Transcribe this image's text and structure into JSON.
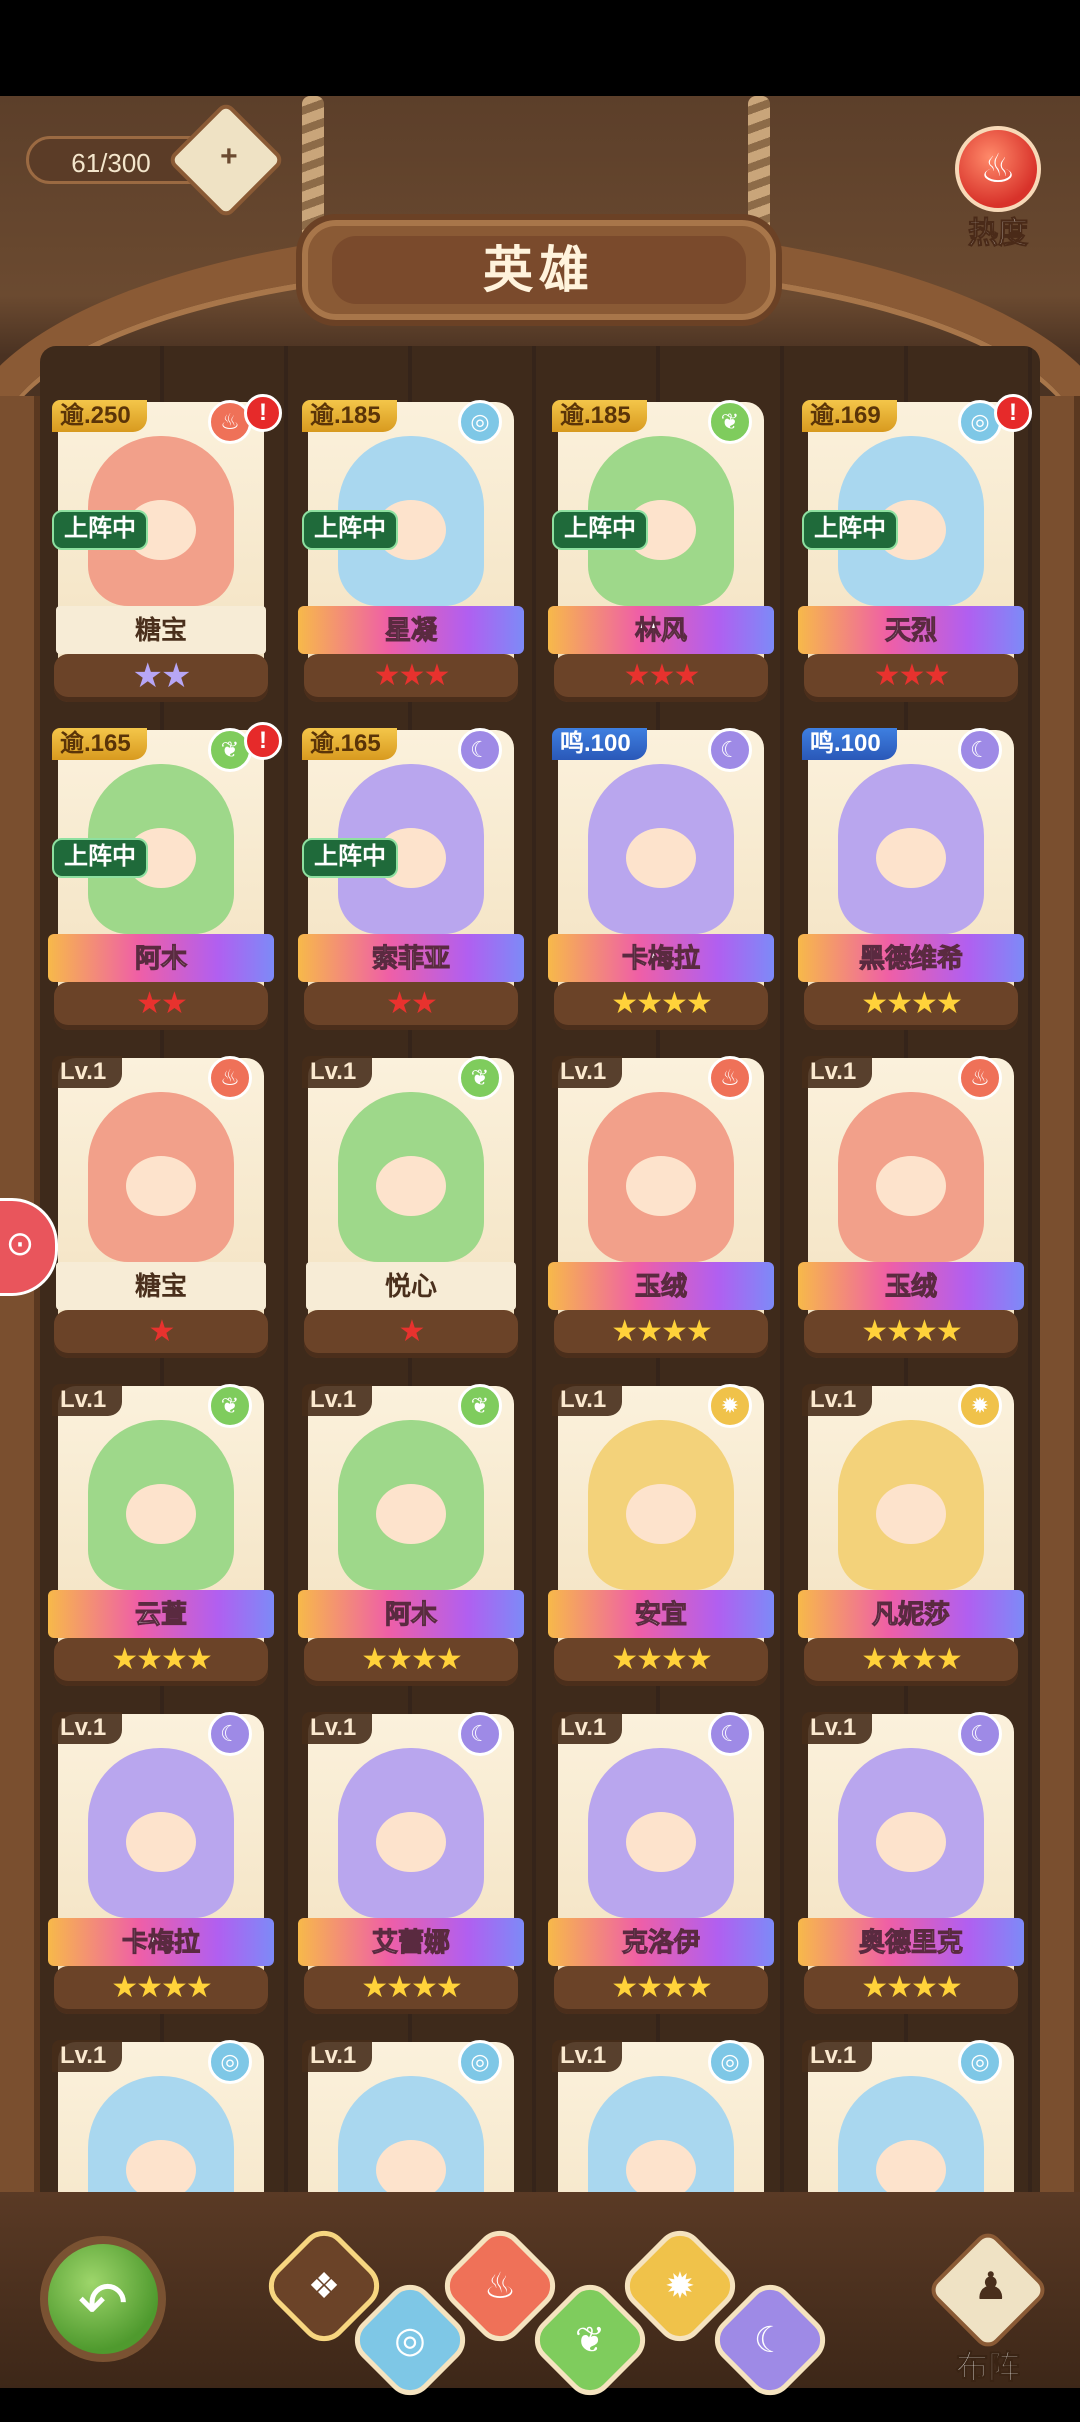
{
  "header": {
    "counter": "61/300",
    "counter_icon": "hero-capacity-icon",
    "hot_label": "热度",
    "title": "英雄"
  },
  "colors": {
    "fire": "#ef7158",
    "water": "#7ec7e6",
    "leaf": "#7fcc5d",
    "moon": "#9e8ae6",
    "sun": "#f0c24a"
  },
  "heroes": [
    {
      "tag": "逾.250",
      "tag_style": "gold",
      "element": "fire",
      "alert": "!",
      "active": "上阵中",
      "name": "糖宝",
      "stars": "★★",
      "stars_style": "purple",
      "ribbon": "plain"
    },
    {
      "tag": "逾.185",
      "tag_style": "gold",
      "element": "water",
      "alert": "",
      "active": "上阵中",
      "name": "星凝",
      "stars": "★★★",
      "stars_style": "red",
      "ribbon": "rainbow"
    },
    {
      "tag": "逾.185",
      "tag_style": "gold",
      "element": "leaf",
      "alert": "",
      "active": "上阵中",
      "name": "林风",
      "stars": "★★★",
      "stars_style": "red",
      "ribbon": "rainbow"
    },
    {
      "tag": "逾.169",
      "tag_style": "gold",
      "element": "water",
      "alert": "!",
      "active": "上阵中",
      "name": "天烈",
      "stars": "★★★",
      "stars_style": "red",
      "ribbon": "rainbow"
    },
    {
      "tag": "逾.165",
      "tag_style": "gold",
      "element": "leaf",
      "alert": "!",
      "active": "上阵中",
      "name": "阿木",
      "stars": "★★",
      "stars_style": "red",
      "ribbon": "rainbow"
    },
    {
      "tag": "逾.165",
      "tag_style": "gold",
      "element": "moon",
      "alert": "",
      "active": "上阵中",
      "name": "索菲亚",
      "stars": "★★",
      "stars_style": "red",
      "ribbon": "rainbow"
    },
    {
      "tag": "鸣.100",
      "tag_style": "blue",
      "element": "moon",
      "alert": "",
      "active": "",
      "name": "卡梅拉",
      "stars": "★★★★",
      "stars_style": "gold",
      "ribbon": "rainbow"
    },
    {
      "tag": "鸣.100",
      "tag_style": "blue",
      "element": "moon",
      "alert": "",
      "active": "",
      "name": "黑德维希",
      "stars": "★★★★",
      "stars_style": "gold",
      "ribbon": "rainbow"
    },
    {
      "tag": "Lv.1",
      "tag_style": "dark",
      "element": "fire",
      "alert": "",
      "active": "",
      "name": "糖宝",
      "stars": "★",
      "stars_style": "red",
      "ribbon": "plain"
    },
    {
      "tag": "Lv.1",
      "tag_style": "dark",
      "element": "leaf",
      "alert": "",
      "active": "",
      "name": "悦心",
      "stars": "★",
      "stars_style": "red",
      "ribbon": "plain"
    },
    {
      "tag": "Lv.1",
      "tag_style": "dark",
      "element": "fire",
      "alert": "",
      "active": "",
      "name": "玉绒",
      "stars": "★★★★",
      "stars_style": "gold",
      "ribbon": "rainbow"
    },
    {
      "tag": "Lv.1",
      "tag_style": "dark",
      "element": "fire",
      "alert": "",
      "active": "",
      "name": "玉绒",
      "stars": "★★★★",
      "stars_style": "gold",
      "ribbon": "rainbow"
    },
    {
      "tag": "Lv.1",
      "tag_style": "dark",
      "element": "leaf",
      "alert": "",
      "active": "",
      "name": "云萱",
      "stars": "★★★★",
      "stars_style": "gold",
      "ribbon": "rainbow"
    },
    {
      "tag": "Lv.1",
      "tag_style": "dark",
      "element": "leaf",
      "alert": "",
      "active": "",
      "name": "阿木",
      "stars": "★★★★",
      "stars_style": "gold",
      "ribbon": "rainbow"
    },
    {
      "tag": "Lv.1",
      "tag_style": "dark",
      "element": "sun",
      "alert": "",
      "active": "",
      "name": "安宜",
      "stars": "★★★★",
      "stars_style": "gold",
      "ribbon": "rainbow"
    },
    {
      "tag": "Lv.1",
      "tag_style": "dark",
      "element": "sun",
      "alert": "",
      "active": "",
      "name": "凡妮莎",
      "stars": "★★★★",
      "stars_style": "gold",
      "ribbon": "rainbow"
    },
    {
      "tag": "Lv.1",
      "tag_style": "dark",
      "element": "moon",
      "alert": "",
      "active": "",
      "name": "卡梅拉",
      "stars": "★★★★",
      "stars_style": "gold",
      "ribbon": "rainbow"
    },
    {
      "tag": "Lv.1",
      "tag_style": "dark",
      "element": "moon",
      "alert": "",
      "active": "",
      "name": "艾蕾娜",
      "stars": "★★★★",
      "stars_style": "gold",
      "ribbon": "rainbow"
    },
    {
      "tag": "Lv.1",
      "tag_style": "dark",
      "element": "moon",
      "alert": "",
      "active": "",
      "name": "克洛伊",
      "stars": "★★★★",
      "stars_style": "gold",
      "ribbon": "rainbow"
    },
    {
      "tag": "Lv.1",
      "tag_style": "dark",
      "element": "moon",
      "alert": "",
      "active": "",
      "name": "奥德里克",
      "stars": "★★★★",
      "stars_style": "gold",
      "ribbon": "rainbow"
    },
    {
      "tag": "Lv.1",
      "tag_style": "dark",
      "element": "water",
      "alert": "",
      "active": "",
      "name": "",
      "stars": "",
      "stars_style": "gold",
      "ribbon": "none"
    },
    {
      "tag": "Lv.1",
      "tag_style": "dark",
      "element": "water",
      "alert": "",
      "active": "",
      "name": "",
      "stars": "",
      "stars_style": "gold",
      "ribbon": "none"
    },
    {
      "tag": "Lv.1",
      "tag_style": "dark",
      "element": "water",
      "alert": "",
      "active": "",
      "name": "",
      "stars": "",
      "stars_style": "gold",
      "ribbon": "none"
    },
    {
      "tag": "Lv.1",
      "tag_style": "dark",
      "element": "water",
      "alert": "",
      "active": "",
      "name": "",
      "stars": "",
      "stars_style": "gold",
      "ribbon": "none"
    }
  ],
  "element_icons": {
    "fire": "fire-icon",
    "water": "water-icon",
    "leaf": "leaf-icon",
    "moon": "moon-icon",
    "sun": "sun-icon"
  },
  "element_glyphs": {
    "fire": "♨",
    "water": "◎",
    "leaf": "❦",
    "moon": "☾",
    "sun": "✹"
  },
  "bottom": {
    "back_icon": "back-arrow-icon",
    "filters": [
      {
        "name": "all",
        "icon": "all-elements-icon",
        "glyph": "❖"
      },
      {
        "name": "water",
        "icon": "water-icon",
        "glyph": "◎"
      },
      {
        "name": "fire",
        "icon": "fire-icon",
        "glyph": "♨"
      },
      {
        "name": "leaf",
        "icon": "leaf-icon",
        "glyph": "❦"
      },
      {
        "name": "sun",
        "icon": "sun-icon",
        "glyph": "✹"
      },
      {
        "name": "moon",
        "icon": "moon-icon",
        "glyph": "☾"
      }
    ],
    "formation_label": "布阵",
    "formation_icon": "chess-pieces-icon"
  }
}
